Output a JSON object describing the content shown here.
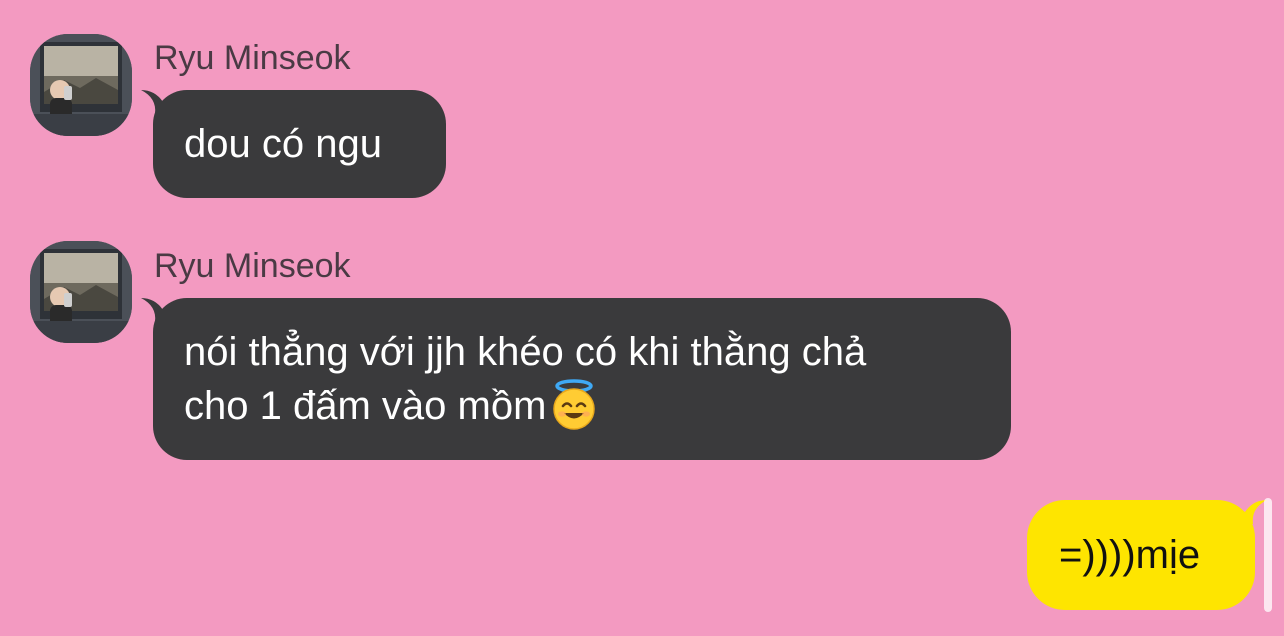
{
  "messages": [
    {
      "sender": "Ryu Minseok",
      "text": "dou có ngu"
    },
    {
      "sender": "Ryu Minseok",
      "text_line1": "nói thẳng với jjh khéo có khi thằng chả",
      "text_line2": "cho 1 đấm vào mồm",
      "emoji": "smiling-face-with-halo"
    },
    {
      "text": "=))))mịe"
    }
  ],
  "colors": {
    "background": "#f39ac1",
    "incoming_bubble": "#3a3a3c",
    "outgoing_bubble": "#fee500"
  }
}
